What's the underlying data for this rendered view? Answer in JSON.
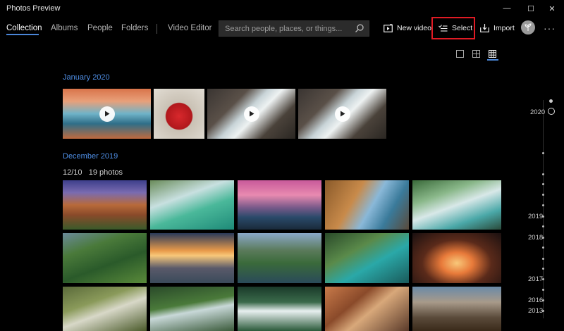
{
  "app": {
    "title": "Photos Preview"
  },
  "window": {
    "minimize": "—",
    "maximize": "☐",
    "close": "✕"
  },
  "nav": {
    "tabs": [
      {
        "label": "Collection",
        "active": true
      },
      {
        "label": "Albums"
      },
      {
        "label": "People"
      },
      {
        "label": "Folders"
      },
      {
        "label": "Video Editor"
      }
    ]
  },
  "search": {
    "placeholder": "Search people, places, or things..."
  },
  "commands": {
    "new_video": "New video",
    "select": "Select",
    "import": "Import",
    "more": "···"
  },
  "view_toggles": [
    {
      "name": "single",
      "active": false
    },
    {
      "name": "medium",
      "active": false
    },
    {
      "name": "small",
      "active": true
    }
  ],
  "sections": [
    {
      "header": "January 2020",
      "items": [
        "video-ice",
        "photo-apple",
        "video-waterfall",
        "video-waterfall"
      ]
    },
    {
      "header": "December 2019",
      "day": "12/10",
      "count": "19 photos"
    }
  ],
  "timeline": {
    "years": [
      "2020",
      "2019",
      "2018",
      "2017",
      "2016",
      "2013"
    ]
  },
  "colors": {
    "accent": "#4a86d8",
    "highlight": "#e01b24",
    "background": "#000000"
  }
}
